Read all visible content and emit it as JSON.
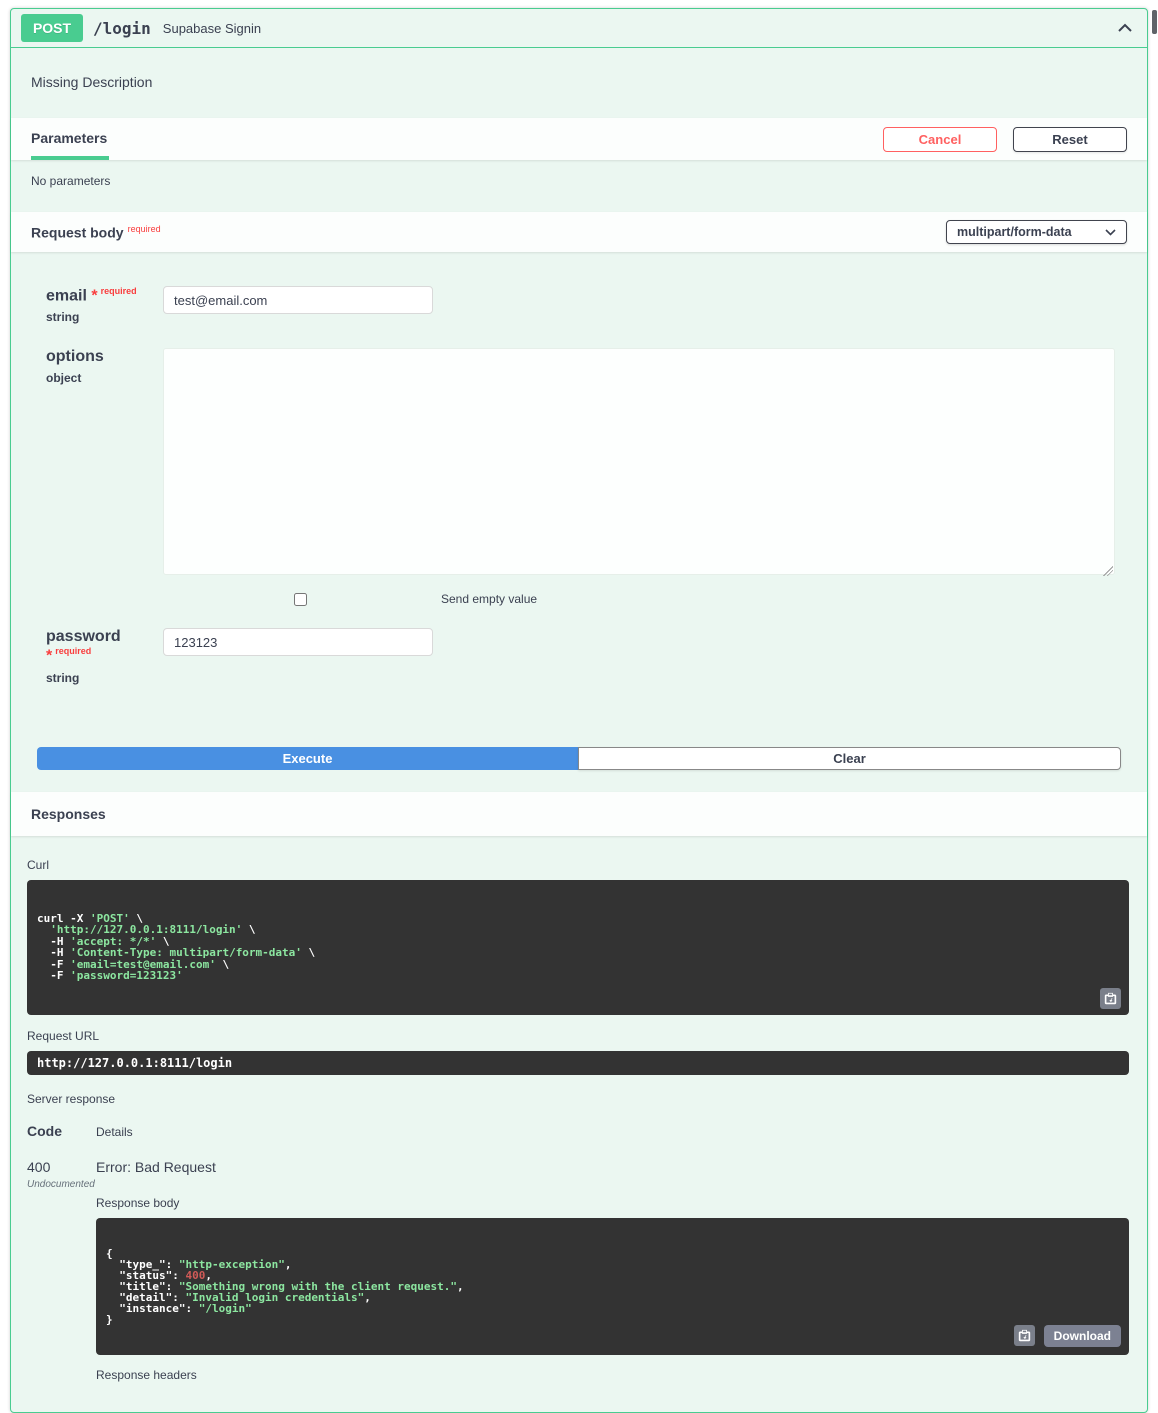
{
  "header": {
    "method": "POST",
    "path": "/login",
    "description": "Supabase Signin"
  },
  "missing_description": "Missing Description",
  "parameters": {
    "title": "Parameters",
    "cancel_label": "Cancel",
    "reset_label": "Reset",
    "empty_text": "No parameters"
  },
  "request_body": {
    "title": "Request body",
    "required_tag": "required",
    "content_type": "multipart/form-data",
    "email": {
      "name": "email",
      "star": "*",
      "required": "required",
      "type": "string",
      "value": "test@email.com"
    },
    "options": {
      "name": "options",
      "type": "object",
      "value": ""
    },
    "send_empty_value_label": "Send empty value",
    "password": {
      "name": "password",
      "star": "*",
      "required": "required",
      "type": "string",
      "value": "123123"
    }
  },
  "actions": {
    "execute_label": "Execute",
    "clear_label": "Clear"
  },
  "responses": {
    "title": "Responses",
    "curl_label": "Curl",
    "curl_lines": [
      [
        {
          "c": "p",
          "v": "curl -X "
        },
        {
          "c": "s",
          "v": "'POST'"
        },
        {
          "c": "p",
          "v": " \\"
        }
      ],
      [
        {
          "c": "p",
          "v": "  "
        },
        {
          "c": "s",
          "v": "'http://127.0.0.1:8111/login'"
        },
        {
          "c": "p",
          "v": " \\"
        }
      ],
      [
        {
          "c": "p",
          "v": "  -H "
        },
        {
          "c": "s",
          "v": "'accept: */*'"
        },
        {
          "c": "p",
          "v": " \\"
        }
      ],
      [
        {
          "c": "p",
          "v": "  -H "
        },
        {
          "c": "s",
          "v": "'Content-Type: multipart/form-data'"
        },
        {
          "c": "p",
          "v": " \\"
        }
      ],
      [
        {
          "c": "p",
          "v": "  -F "
        },
        {
          "c": "s",
          "v": "'email=test@email.com'"
        },
        {
          "c": "p",
          "v": " \\"
        }
      ],
      [
        {
          "c": "p",
          "v": "  -F "
        },
        {
          "c": "s",
          "v": "'password=123123'"
        }
      ]
    ],
    "request_url_label": "Request URL",
    "request_url": "http://127.0.0.1:8111/login",
    "server_response_label": "Server response",
    "code_header": "Code",
    "details_header": "Details",
    "status_code": "400",
    "undocumented_tag": "Undocumented",
    "error_text": "Error: Bad Request",
    "response_body_label": "Response body",
    "response_body_lines": [
      [
        {
          "c": "p",
          "v": "{"
        }
      ],
      [
        {
          "c": "p",
          "v": "  \"type_\": "
        },
        {
          "c": "s",
          "v": "\"http-exception\""
        },
        {
          "c": "p",
          "v": ","
        }
      ],
      [
        {
          "c": "p",
          "v": "  \"status\": "
        },
        {
          "c": "n",
          "v": "400"
        },
        {
          "c": "p",
          "v": ","
        }
      ],
      [
        {
          "c": "p",
          "v": "  \"title\": "
        },
        {
          "c": "s",
          "v": "\"Something wrong with the client request.\""
        },
        {
          "c": "p",
          "v": ","
        }
      ],
      [
        {
          "c": "p",
          "v": "  \"detail\": "
        },
        {
          "c": "s",
          "v": "\"Invalid login credentials\""
        },
        {
          "c": "p",
          "v": ","
        }
      ],
      [
        {
          "c": "p",
          "v": "  \"instance\": "
        },
        {
          "c": "s",
          "v": "\"/login\""
        }
      ],
      [
        {
          "c": "p",
          "v": "}"
        }
      ]
    ],
    "download_label": "Download",
    "response_headers_label": "Response headers"
  },
  "colors": {
    "method_green": "#49cc90",
    "execute_blue": "#4990e2",
    "cancel_red": "#ff6060"
  }
}
